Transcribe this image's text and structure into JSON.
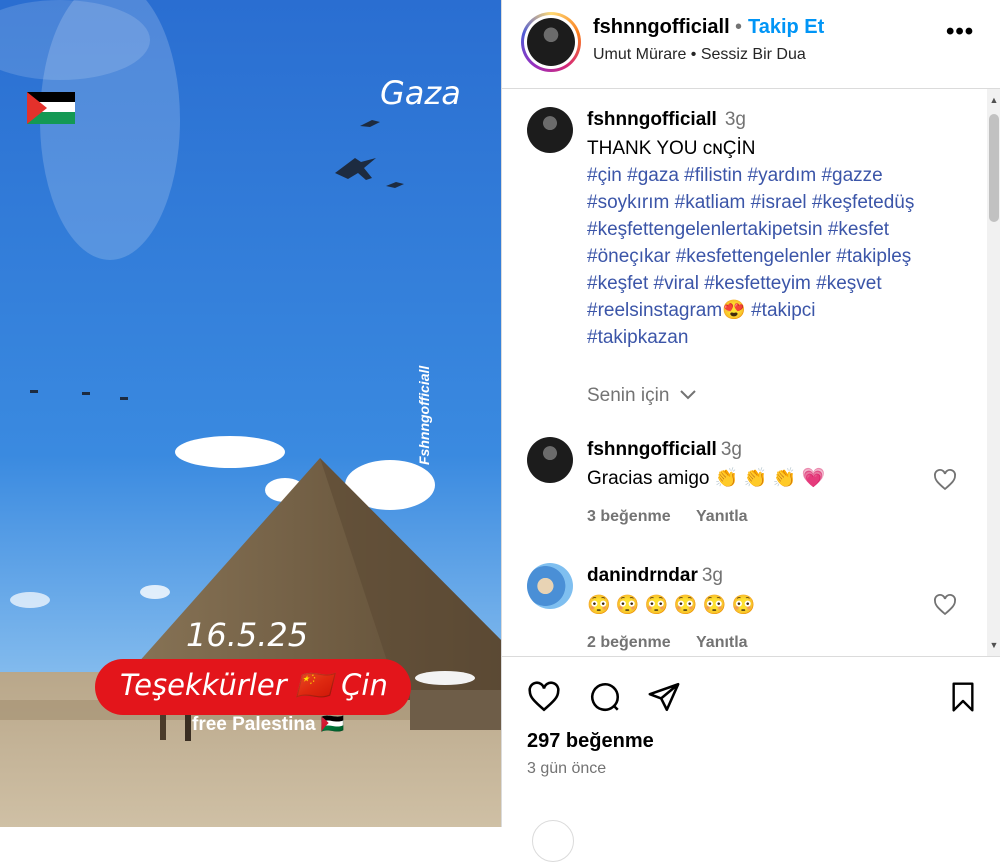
{
  "media": {
    "overlay_gaza": "Gaza",
    "overlay_date": "16.5.25",
    "banner_text": "Teşekkürler 🇨🇳 Çin",
    "free_text": "free Palestina 🇵🇸",
    "watermark": "Fshnngofficiall"
  },
  "header": {
    "username": "fshnngofficiall",
    "dot": "•",
    "follow_label": "Takip Et",
    "audio": "Umut Mürare • Sessiz Bir Dua",
    "more_label": "•••"
  },
  "caption": {
    "username": "fshnngofficiall",
    "time": "3g",
    "text": "THANK YOU ᴄɴÇİN",
    "hashtag_lines": [
      "#çin #gaza #filistin #yardım #gazze",
      "#soykırım #katliam #israel #keşfetedüş",
      "#keşfettengelenlertakipetsin #kesfet",
      "#öneçıkar #kesfettengelenler #takipleş",
      "#keşfet #viral #kesfetteyim #keşvet",
      "#reelsinstagram😍 #takipci",
      "#takipkazan"
    ],
    "for_you_label": "Senin için"
  },
  "comments": [
    {
      "username": "fshnngofficiall",
      "time": "3g",
      "text": "Gracias amigo 👏 👏 👏 💗",
      "likes": "3 beğenme",
      "reply": "Yanıtla"
    },
    {
      "username": "danindrndar",
      "time": "3g",
      "text": "😳 😳 😳 😳 😳 😳",
      "likes": "2 beğenme",
      "reply": "Yanıtla"
    }
  ],
  "footer": {
    "likes": "297 beğenme",
    "time_ago": "3 gün önce"
  },
  "colors": {
    "follow": "#0095f6",
    "hashtag": "#3b55a8",
    "banner": "#e3151b"
  }
}
